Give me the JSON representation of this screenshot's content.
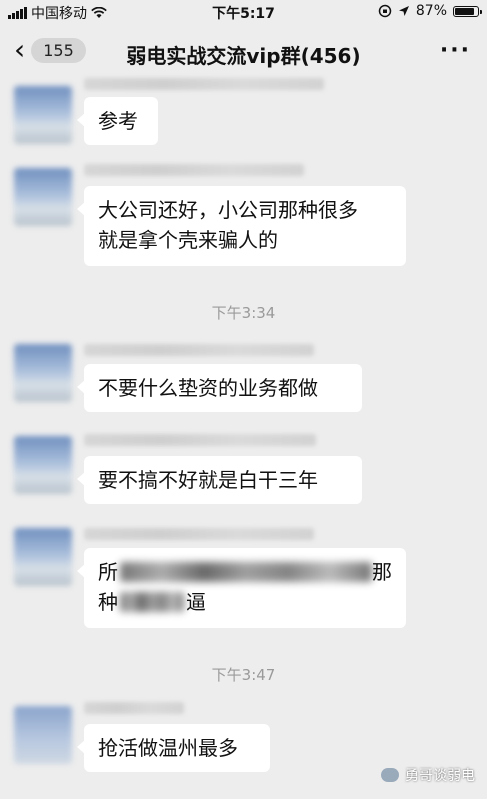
{
  "status_bar": {
    "carrier": "中国移动",
    "time": "下午5:17",
    "battery": "87%",
    "battery_level": 0.87
  },
  "nav": {
    "unread_count": "155",
    "title": "弱电实战交流vip群(456)"
  },
  "messages": [
    {
      "text": "参考"
    },
    {
      "text_line1": "大公司还好，小公司那种很多",
      "text_line2": "就是拿个壳来骗人的"
    },
    {
      "time": "下午3:34"
    },
    {
      "text": "不要什么垫资的业务都做"
    },
    {
      "text": "要不搞不好就是白干三年"
    },
    {
      "text_line1_start": "所",
      "text_line1_end": "那",
      "text_line2_start": "种",
      "text_line2_end": "逼"
    },
    {
      "time": "下午3:47"
    },
    {
      "text": "抢活做温州最多"
    }
  ],
  "watermark": "勇哥谈弱电"
}
